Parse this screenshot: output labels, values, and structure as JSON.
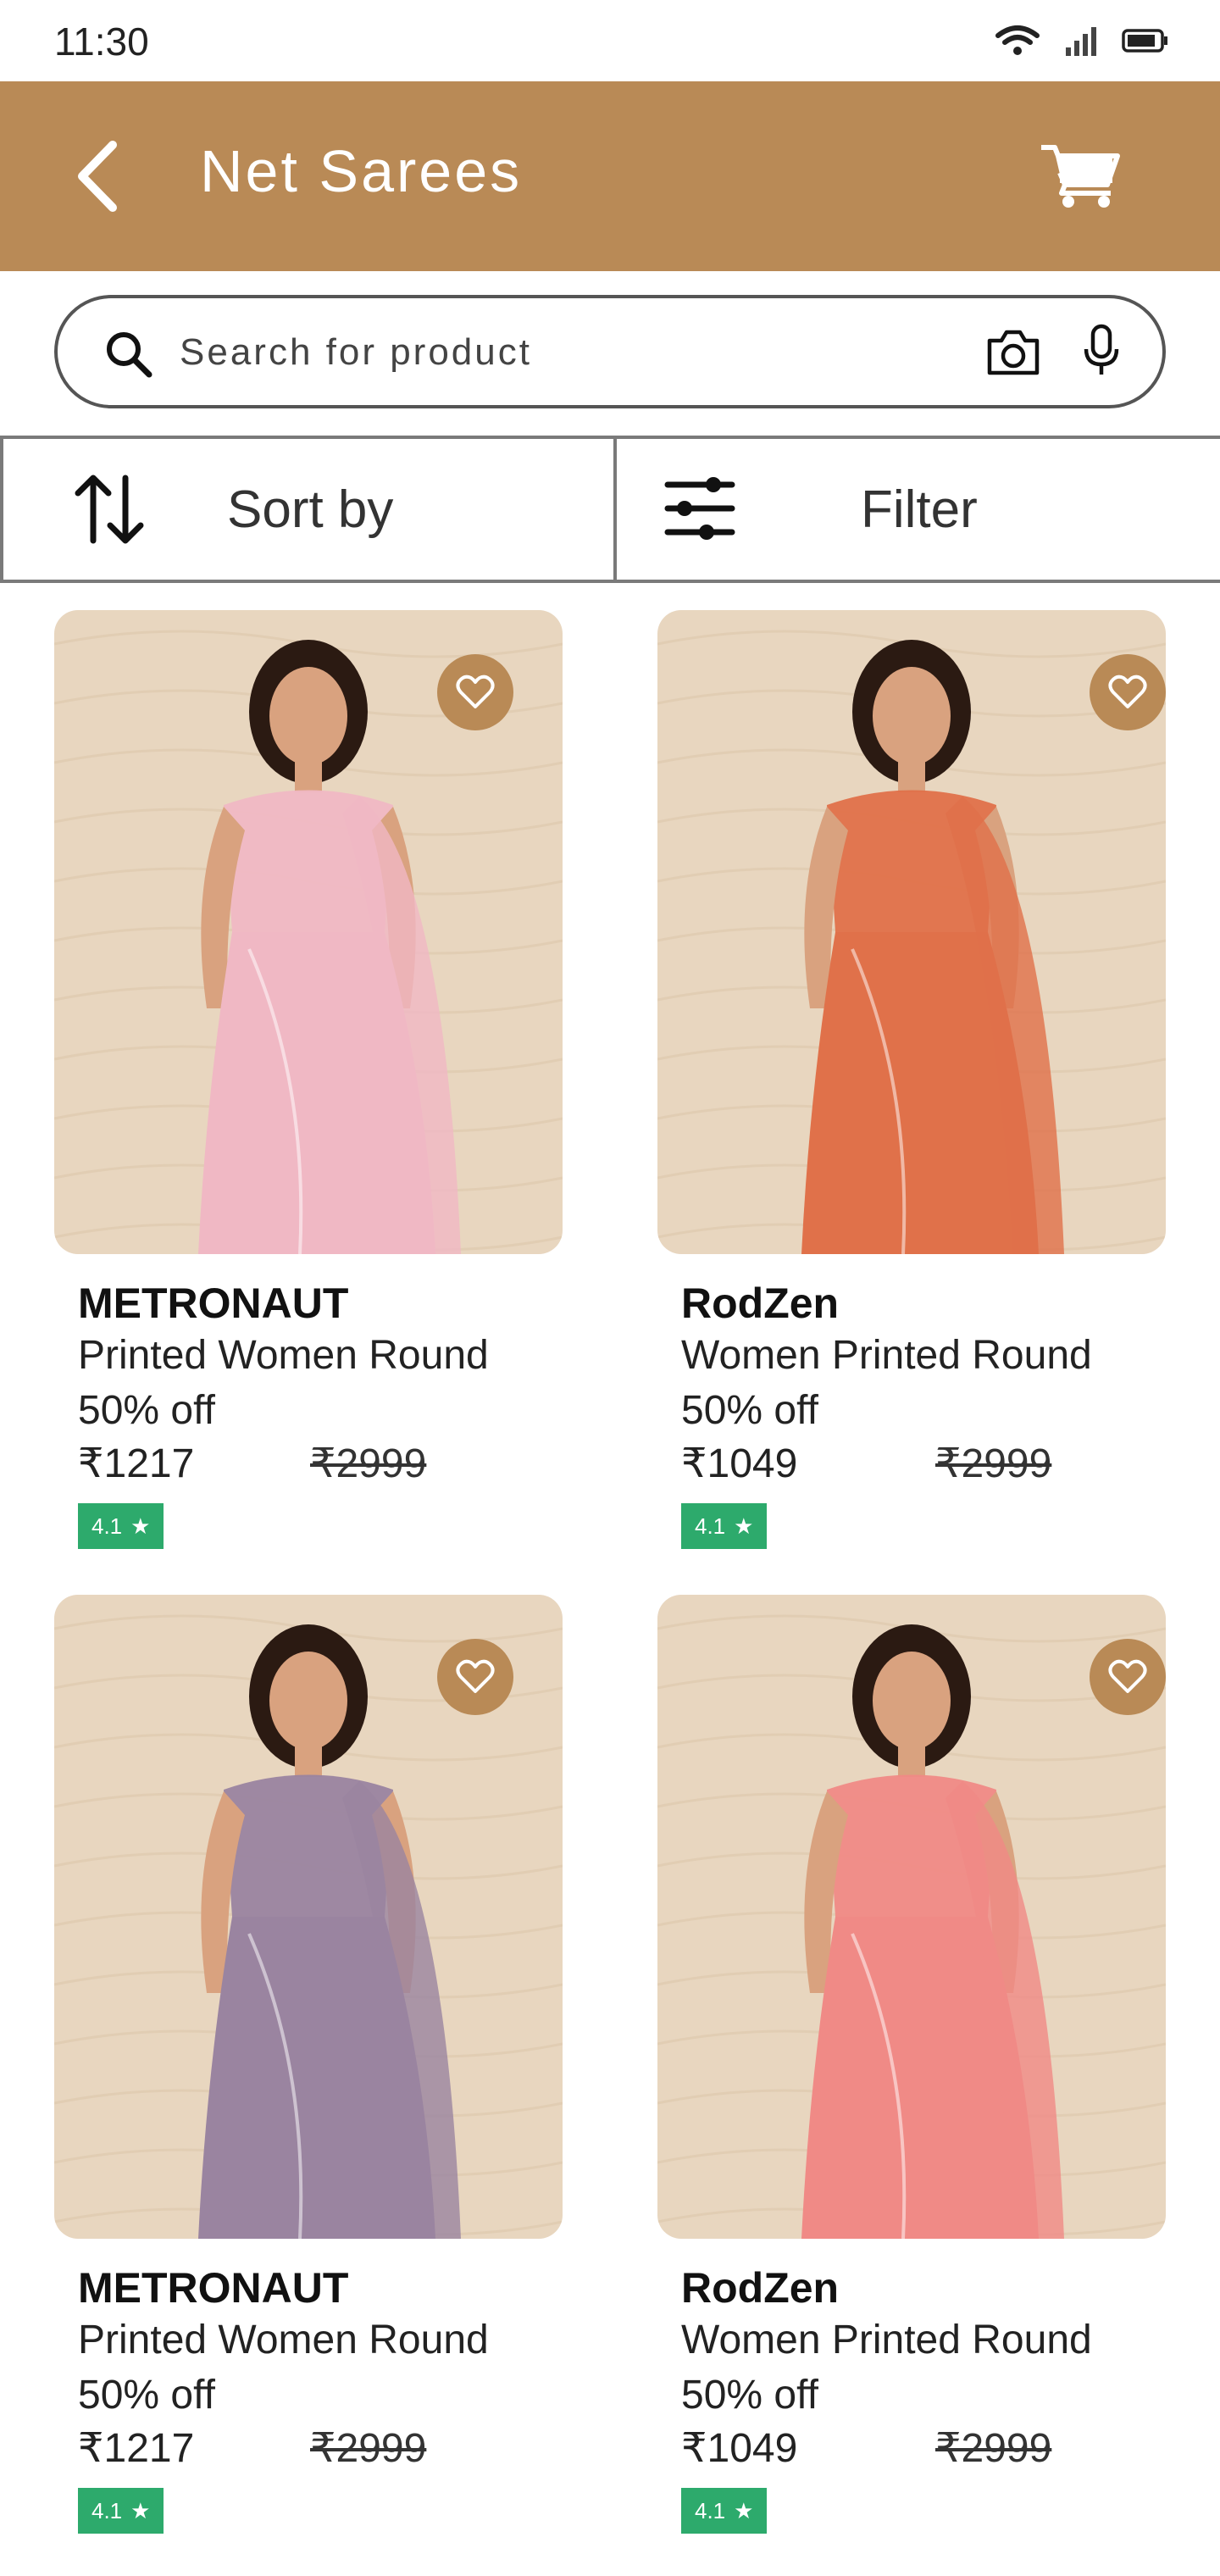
{
  "status_bar": {
    "time": "11:30"
  },
  "app_bar": {
    "title": "Net Sarees"
  },
  "search": {
    "placeholder": "Search for product"
  },
  "controls": {
    "sort_label": "Sort by",
    "filter_label": "Filter"
  },
  "products": [
    {
      "brand": "METRONAUT",
      "name": "Printed Women Round",
      "discount": "50% off",
      "price": "₹1217",
      "mrp": "₹2999",
      "rating": "4.1",
      "color": "#f0b8c4"
    },
    {
      "brand": "RodZen",
      "name": "Women Printed Round",
      "discount": "50% off",
      "price": "₹1049",
      "mrp": "₹2999",
      "rating": "4.1",
      "color": "#e0714a"
    },
    {
      "brand": "METRONAUT",
      "name": "Printed Women Round",
      "discount": "50% off",
      "price": "₹1217",
      "mrp": "₹2999",
      "rating": "4.1",
      "color": "#9a84a0"
    },
    {
      "brand": "RodZen",
      "name": "Women Printed Round",
      "discount": "50% off",
      "price": "₹1049",
      "mrp": "₹2999",
      "rating": "4.1",
      "color": "#f08a86"
    }
  ],
  "colors": {
    "accent": "#b98a56",
    "rating_bg": "#2daa6c",
    "image_bg": "#e8d6bf"
  }
}
